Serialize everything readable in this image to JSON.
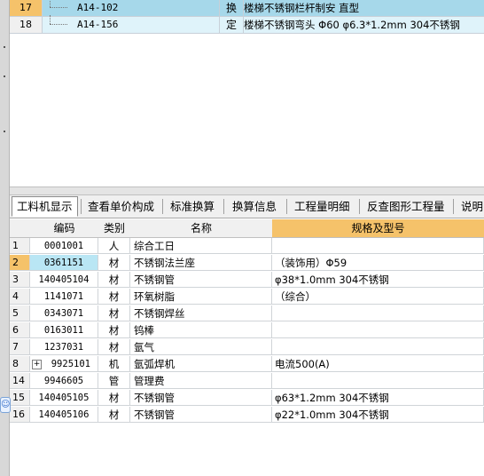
{
  "top_grid": {
    "rows": [
      {
        "num": "17",
        "code": "A14-102",
        "type": "换",
        "name": "楼梯不锈钢栏杆制安 直型",
        "selected": true
      },
      {
        "num": "18",
        "code": "A14-156",
        "type": "定",
        "name": "楼梯不锈钢弯头 Φ60 φ6.3*1.2mm 304不锈钢",
        "selected": false
      }
    ]
  },
  "tabs": [
    {
      "label": "工料机显示",
      "active": true
    },
    {
      "label": "查看单价构成",
      "active": false
    },
    {
      "label": "标准换算",
      "active": false
    },
    {
      "label": "换算信息",
      "active": false
    },
    {
      "label": "工程量明细",
      "active": false
    },
    {
      "label": "反查图形工程量",
      "active": false
    },
    {
      "label": "说明",
      "active": false
    }
  ],
  "bottom_grid": {
    "headers": {
      "code": "编码",
      "type": "类别",
      "name": "名称",
      "spec": "规格及型号"
    },
    "rows": [
      {
        "num": "1",
        "code": "0001001",
        "type": "人",
        "name": "综合工日",
        "spec": ""
      },
      {
        "num": "2",
        "code": "0361151",
        "type": "材",
        "name": "不锈钢法兰座",
        "spec": "（装饰用）Φ59"
      },
      {
        "num": "3",
        "code": "140405104",
        "type": "材",
        "name": "不锈钢管",
        "spec": "φ38*1.0mm 304不锈钢"
      },
      {
        "num": "4",
        "code": "1141071",
        "type": "材",
        "name": "环氧树脂",
        "spec": "（综合）"
      },
      {
        "num": "5",
        "code": "0343071",
        "type": "材",
        "name": "不锈钢焊丝",
        "spec": ""
      },
      {
        "num": "6",
        "code": "0163011",
        "type": "材",
        "name": "钨棒",
        "spec": ""
      },
      {
        "num": "7",
        "code": "1237031",
        "type": "材",
        "name": "氩气",
        "spec": ""
      },
      {
        "num": "8",
        "code": "9925101",
        "type": "机",
        "name": "氩弧焊机",
        "spec": "电流500(A)",
        "expandable": true,
        "expander": "+"
      },
      {
        "num": "14",
        "code": "9946605",
        "type": "管",
        "name": "管理费",
        "spec": ""
      },
      {
        "num": "15",
        "code": "140405105",
        "type": "材",
        "name": "不锈钢管",
        "spec": "φ63*1.2mm 304不锈钢"
      },
      {
        "num": "16",
        "code": "140405106",
        "type": "材",
        "name": "不锈钢管",
        "spec": "φ22*1.0mm 304不锈钢"
      }
    ]
  },
  "colors": {
    "selected_row": "#a6d8ea",
    "selected_num": "#f5c26a",
    "row2_num": "#f5c26a",
    "row2_code": "#b9e6f4",
    "spec_header": "#f5c26a"
  },
  "icons": {
    "float_tool": "smiley-icon"
  }
}
